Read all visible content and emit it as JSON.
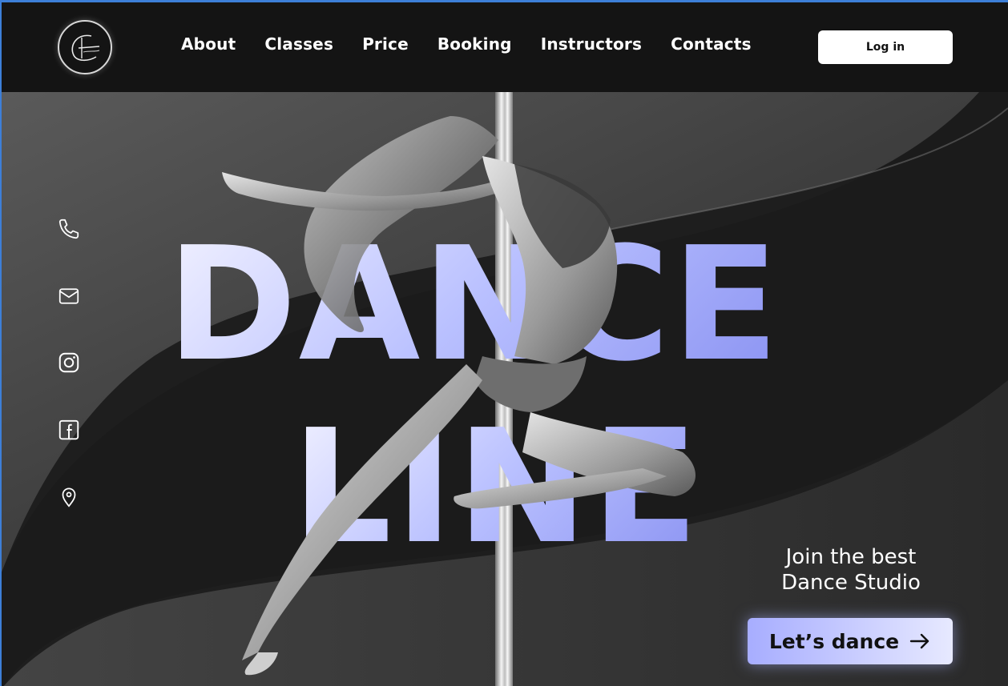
{
  "nav": {
    "items": [
      "About",
      "Classes",
      "Price",
      "Booking",
      "Instructors",
      "Contacts"
    ],
    "login_label": "Log in"
  },
  "hero": {
    "headline_line1": "DANCE",
    "headline_line2": "LINE",
    "tagline_line1": "Join the best",
    "tagline_line2": "Dance Studio",
    "cta_label": "Let’s dance"
  },
  "socials": [
    "phone-icon",
    "mail-icon",
    "instagram-icon",
    "facebook-icon",
    "location-icon"
  ],
  "colors": {
    "background": "#141414",
    "accent_start": "#a7adff",
    "accent_end": "#e7e9ff",
    "text": "#ffffff"
  }
}
